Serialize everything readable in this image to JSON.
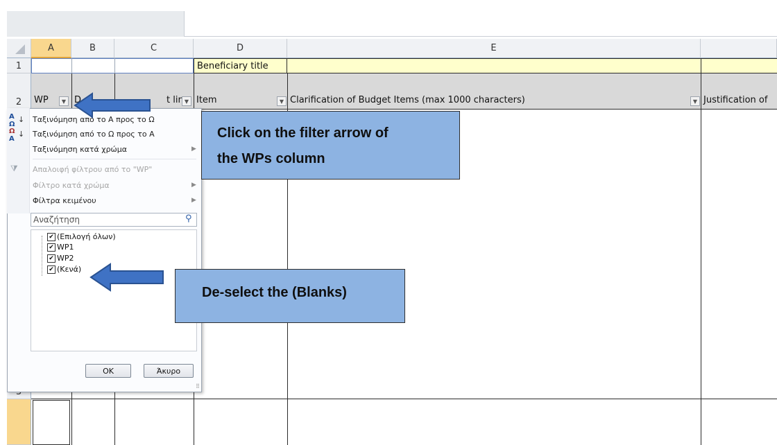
{
  "columns": [
    "A",
    "B",
    "C",
    "D",
    "E"
  ],
  "rows": [
    "1",
    "2",
    "3"
  ],
  "cells": {
    "d1": "Beneficiary title",
    "a2": "WP",
    "b2": "D",
    "c2": "t line",
    "d2": "Item",
    "e2": "Clarification of Budget Items (max 1000 characters)",
    "f2": "Justification of"
  },
  "menu": {
    "sort_az": "Ταξινόμηση από το Α προς το Ω",
    "sort_za": "Ταξινόμηση από το Ω προς το Α",
    "sort_color": "Ταξινόμηση κατά χρώμα",
    "clear_filter": "Απαλοιφή φίλτρου από το \"WP\"",
    "filter_color": "Φίλτρο κατά χρώμα",
    "text_filters": "Φίλτρα κειμένου",
    "search_placeholder": "Αναζήτηση",
    "options": [
      {
        "label": "(Επιλογή όλων)",
        "checked": true
      },
      {
        "label": "WP1",
        "checked": true
      },
      {
        "label": "WP2",
        "checked": true
      },
      {
        "label": "(Κενά)",
        "checked": true
      }
    ],
    "ok": "OK",
    "cancel": "Άκυρο"
  },
  "callouts": {
    "filter_line1": "Click on the filter arrow of",
    "filter_line2": "the WPs column",
    "deselect": "De-select the (Blanks)"
  },
  "colors": {
    "callout": "#8db3e2",
    "row1_highlight": "#ffffcc",
    "header_grey": "#d9d9d9",
    "selected_header": "#f9d78e",
    "arrow_fill": "#3f72c4"
  }
}
